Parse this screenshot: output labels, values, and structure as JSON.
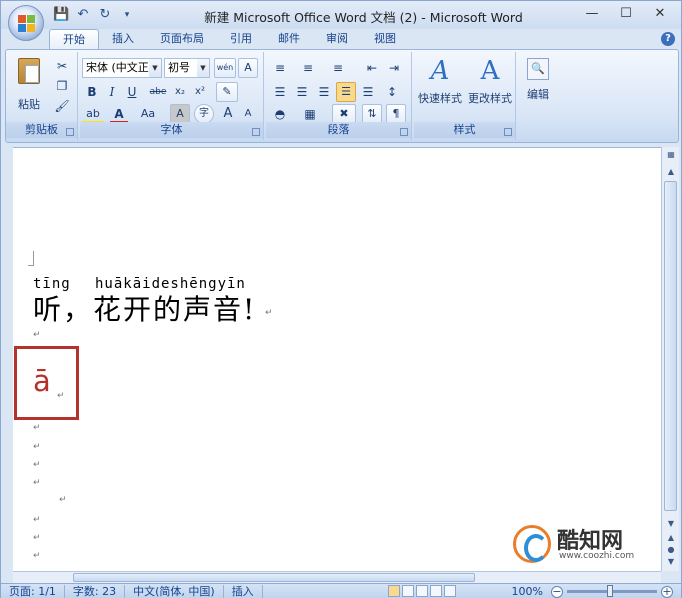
{
  "window": {
    "title": "新建 Microsoft Office Word 文档 (2) - Microsoft Word",
    "controls": [
      "—",
      "☐",
      "✕"
    ]
  },
  "quick_access": [
    "save-icon",
    "undo-icon",
    "redo-icon",
    "customize-icon"
  ],
  "tabs": [
    "开始",
    "插入",
    "页面布局",
    "引用",
    "邮件",
    "审阅",
    "视图"
  ],
  "active_tab": "开始",
  "ribbon": {
    "clipboard": {
      "label": "剪贴板",
      "paste": "粘贴"
    },
    "font": {
      "label": "字体",
      "font_name": "宋体 (中文正·",
      "font_size": "初号",
      "bold": "B",
      "italic": "I",
      "underline": "U",
      "strike": "abe",
      "subscript": "x₂",
      "superscript": "x²",
      "font_color": "A",
      "case": "Aa",
      "char_shading": "A",
      "enclose": "字",
      "grow": "A",
      "shrink": "A",
      "phonetic": "wén",
      "border": "A"
    },
    "paragraph": {
      "label": "段落"
    },
    "styles": {
      "label": "样式",
      "quick_styles": "快速样式",
      "change_styles": "更改样式"
    },
    "editing": {
      "label": "编辑"
    }
  },
  "document": {
    "pinyin_1": "tīng",
    "pinyin_2": "huākāideshēngyīn",
    "main_line": "听，花开的声音!",
    "highlight_char": "ā"
  },
  "status": {
    "page": "页面: 1/1",
    "words": "字数: 23",
    "language": "中文(简体, 中国)",
    "mode": "插入",
    "zoom": "100%"
  },
  "watermark": {
    "name": "酷知网",
    "url": "www.coozhi.com"
  },
  "colors": {
    "highlight_red": "#b5322c",
    "ribbon_blue": "#15428b"
  }
}
